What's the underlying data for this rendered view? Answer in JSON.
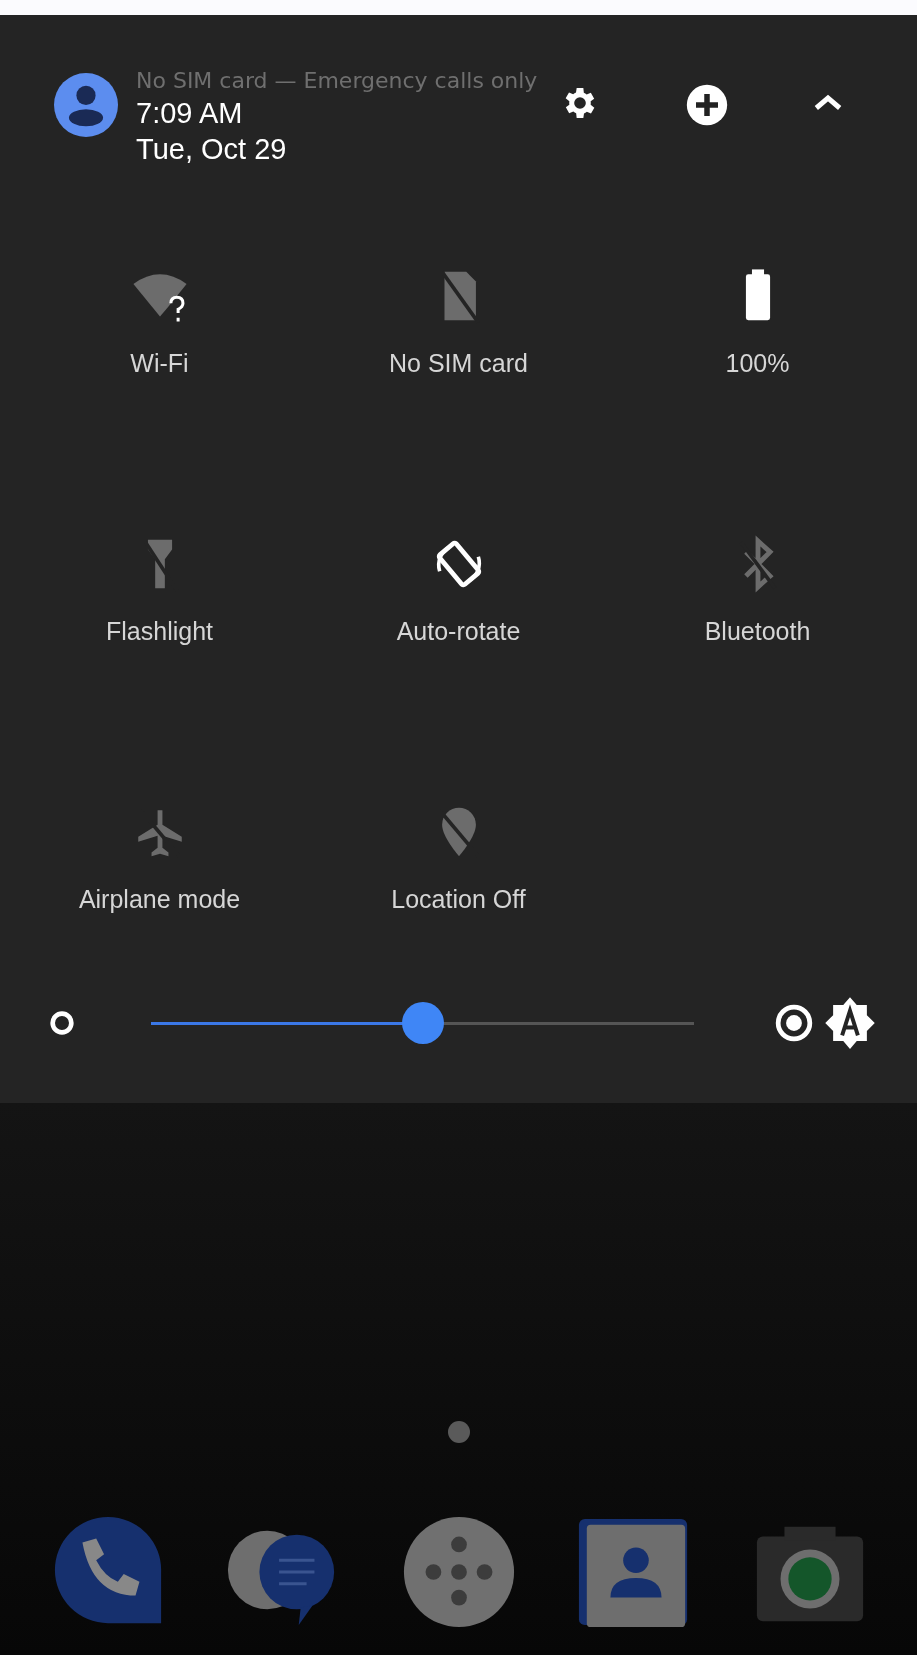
{
  "header": {
    "status": "No SIM card — Emergency calls only",
    "time": "7:09 AM",
    "date": "Tue, Oct 29"
  },
  "tiles": [
    {
      "kind": "wifi",
      "label": "Wi-Fi",
      "on": false
    },
    {
      "kind": "sim",
      "label": "No SIM card",
      "on": false
    },
    {
      "kind": "battery",
      "label": "100%",
      "on": true
    },
    {
      "kind": "flashlight",
      "label": "Flashlight",
      "on": false
    },
    {
      "kind": "rotate",
      "label": "Auto-rotate",
      "on": true
    },
    {
      "kind": "bluetooth",
      "label": "Bluetooth",
      "on": false
    },
    {
      "kind": "airplane",
      "label": "Airplane mode",
      "on": false
    },
    {
      "kind": "location",
      "label": "Location Off",
      "on": false
    }
  ],
  "brightness": {
    "level": 0.5,
    "auto": true
  }
}
